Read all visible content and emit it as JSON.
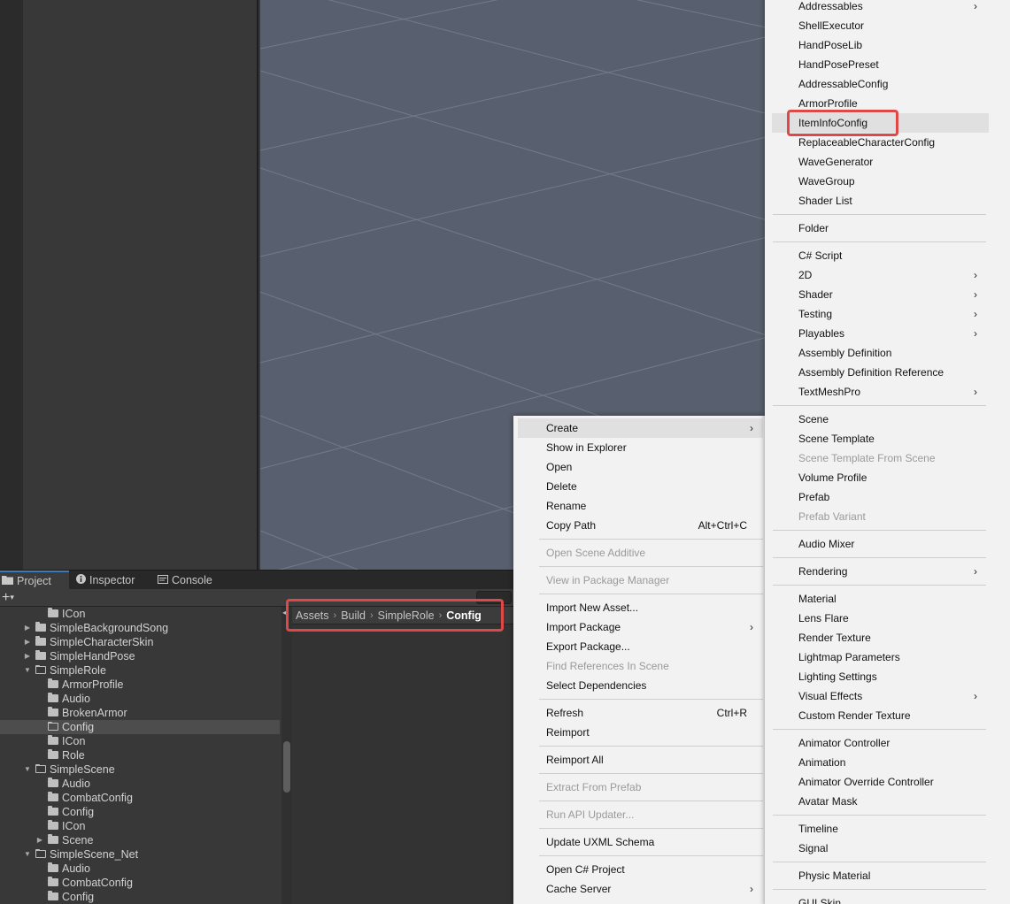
{
  "tabs": [
    {
      "label": "Project",
      "icon": "folder-icon"
    },
    {
      "label": "Inspector",
      "icon": "info-icon"
    },
    {
      "label": "Console",
      "icon": "console-icon"
    }
  ],
  "toolbar": {
    "add_label": "+",
    "add_dropdown": "▾"
  },
  "tree": [
    {
      "label": "ICon",
      "indent": 2,
      "arrow": "",
      "open": false,
      "selected": false
    },
    {
      "label": "SimpleBackgroundSong",
      "indent": 1,
      "arrow": "▶",
      "open": false,
      "selected": false
    },
    {
      "label": "SimpleCharacterSkin",
      "indent": 1,
      "arrow": "▶",
      "open": false,
      "selected": false
    },
    {
      "label": "SimpleHandPose",
      "indent": 1,
      "arrow": "▶",
      "open": false,
      "selected": false
    },
    {
      "label": "SimpleRole",
      "indent": 1,
      "arrow": "▼",
      "open": true,
      "selected": false
    },
    {
      "label": "ArmorProfile",
      "indent": 2,
      "arrow": "",
      "open": false,
      "selected": false
    },
    {
      "label": "Audio",
      "indent": 2,
      "arrow": "",
      "open": false,
      "selected": false
    },
    {
      "label": "BrokenArmor",
      "indent": 2,
      "arrow": "",
      "open": false,
      "selected": false
    },
    {
      "label": "Config",
      "indent": 2,
      "arrow": "",
      "open": true,
      "selected": true
    },
    {
      "label": "ICon",
      "indent": 2,
      "arrow": "",
      "open": false,
      "selected": false
    },
    {
      "label": "Role",
      "indent": 2,
      "arrow": "",
      "open": false,
      "selected": false
    },
    {
      "label": "SimpleScene",
      "indent": 1,
      "arrow": "▼",
      "open": true,
      "selected": false
    },
    {
      "label": "Audio",
      "indent": 2,
      "arrow": "",
      "open": false,
      "selected": false
    },
    {
      "label": "CombatConfig",
      "indent": 2,
      "arrow": "",
      "open": false,
      "selected": false
    },
    {
      "label": "Config",
      "indent": 2,
      "arrow": "",
      "open": false,
      "selected": false
    },
    {
      "label": "ICon",
      "indent": 2,
      "arrow": "",
      "open": false,
      "selected": false
    },
    {
      "label": "Scene",
      "indent": 2,
      "arrow": "▶",
      "open": false,
      "selected": false
    },
    {
      "label": "SimpleScene_Net",
      "indent": 1,
      "arrow": "▼",
      "open": true,
      "selected": false
    },
    {
      "label": "Audio",
      "indent": 2,
      "arrow": "",
      "open": false,
      "selected": false
    },
    {
      "label": "CombatConfig",
      "indent": 2,
      "arrow": "",
      "open": false,
      "selected": false
    },
    {
      "label": "Config",
      "indent": 2,
      "arrow": "",
      "open": false,
      "selected": false
    }
  ],
  "breadcrumb": [
    "Assets",
    "Build",
    "SimpleRole",
    "Config"
  ],
  "breadcrumb_separator": "›",
  "context_menu": [
    {
      "label": "Create",
      "submenu": true,
      "hover": true
    },
    {
      "label": "Show in Explorer"
    },
    {
      "label": "Open"
    },
    {
      "label": "Delete"
    },
    {
      "label": "Rename"
    },
    {
      "label": "Copy Path",
      "shortcut": "Alt+Ctrl+C"
    },
    {
      "sep": true
    },
    {
      "label": "Open Scene Additive",
      "disabled": true
    },
    {
      "sep": true
    },
    {
      "label": "View in Package Manager",
      "disabled": true
    },
    {
      "sep": true
    },
    {
      "label": "Import New Asset..."
    },
    {
      "label": "Import Package",
      "submenu": true
    },
    {
      "label": "Export Package..."
    },
    {
      "label": "Find References In Scene",
      "disabled": true
    },
    {
      "label": "Select Dependencies"
    },
    {
      "sep": true
    },
    {
      "label": "Refresh",
      "shortcut": "Ctrl+R"
    },
    {
      "label": "Reimport"
    },
    {
      "sep": true
    },
    {
      "label": "Reimport All"
    },
    {
      "sep": true
    },
    {
      "label": "Extract From Prefab",
      "disabled": true
    },
    {
      "sep": true
    },
    {
      "label": "Run API Updater...",
      "disabled": true
    },
    {
      "sep": true
    },
    {
      "label": "Update UXML Schema"
    },
    {
      "sep": true
    },
    {
      "label": "Open C# Project"
    },
    {
      "label": "Cache Server",
      "submenu": true
    }
  ],
  "create_menu": [
    {
      "label": "Addressables",
      "submenu": true
    },
    {
      "label": "ShellExecutor"
    },
    {
      "label": "HandPoseLib"
    },
    {
      "label": "HandPosePreset"
    },
    {
      "label": "AddressableConfig"
    },
    {
      "label": "ArmorProfile"
    },
    {
      "label": "ItemInfoConfig",
      "hover": true
    },
    {
      "label": "ReplaceableCharacterConfig"
    },
    {
      "label": "WaveGenerator"
    },
    {
      "label": "WaveGroup"
    },
    {
      "label": "Shader List"
    },
    {
      "sep": true
    },
    {
      "label": "Folder"
    },
    {
      "sep": true
    },
    {
      "label": "C# Script"
    },
    {
      "label": "2D",
      "submenu": true
    },
    {
      "label": "Shader",
      "submenu": true
    },
    {
      "label": "Testing",
      "submenu": true
    },
    {
      "label": "Playables",
      "submenu": true
    },
    {
      "label": "Assembly Definition"
    },
    {
      "label": "Assembly Definition Reference"
    },
    {
      "label": "TextMeshPro",
      "submenu": true
    },
    {
      "sep": true
    },
    {
      "label": "Scene"
    },
    {
      "label": "Scene Template"
    },
    {
      "label": "Scene Template From Scene",
      "disabled": true
    },
    {
      "label": "Volume Profile"
    },
    {
      "label": "Prefab"
    },
    {
      "label": "Prefab Variant",
      "disabled": true
    },
    {
      "sep": true
    },
    {
      "label": "Audio Mixer"
    },
    {
      "sep": true
    },
    {
      "label": "Rendering",
      "submenu": true
    },
    {
      "sep": true
    },
    {
      "label": "Material"
    },
    {
      "label": "Lens Flare"
    },
    {
      "label": "Render Texture"
    },
    {
      "label": "Lightmap Parameters"
    },
    {
      "label": "Lighting Settings"
    },
    {
      "label": "Visual Effects",
      "submenu": true
    },
    {
      "label": "Custom Render Texture"
    },
    {
      "sep": true
    },
    {
      "label": "Animator Controller"
    },
    {
      "label": "Animation"
    },
    {
      "label": "Animator Override Controller"
    },
    {
      "label": "Avatar Mask"
    },
    {
      "sep": true
    },
    {
      "label": "Timeline"
    },
    {
      "label": "Signal"
    },
    {
      "sep": true
    },
    {
      "label": "Physic Material"
    },
    {
      "sep": true
    },
    {
      "label": "GUI Skin"
    }
  ],
  "submenu_arrow": "›",
  "colors": {
    "scene_bg": "#58606f",
    "menu_bg": "#f2f2f2",
    "highlight_red": "#e04848",
    "selection_blue": "#3a79bb"
  }
}
